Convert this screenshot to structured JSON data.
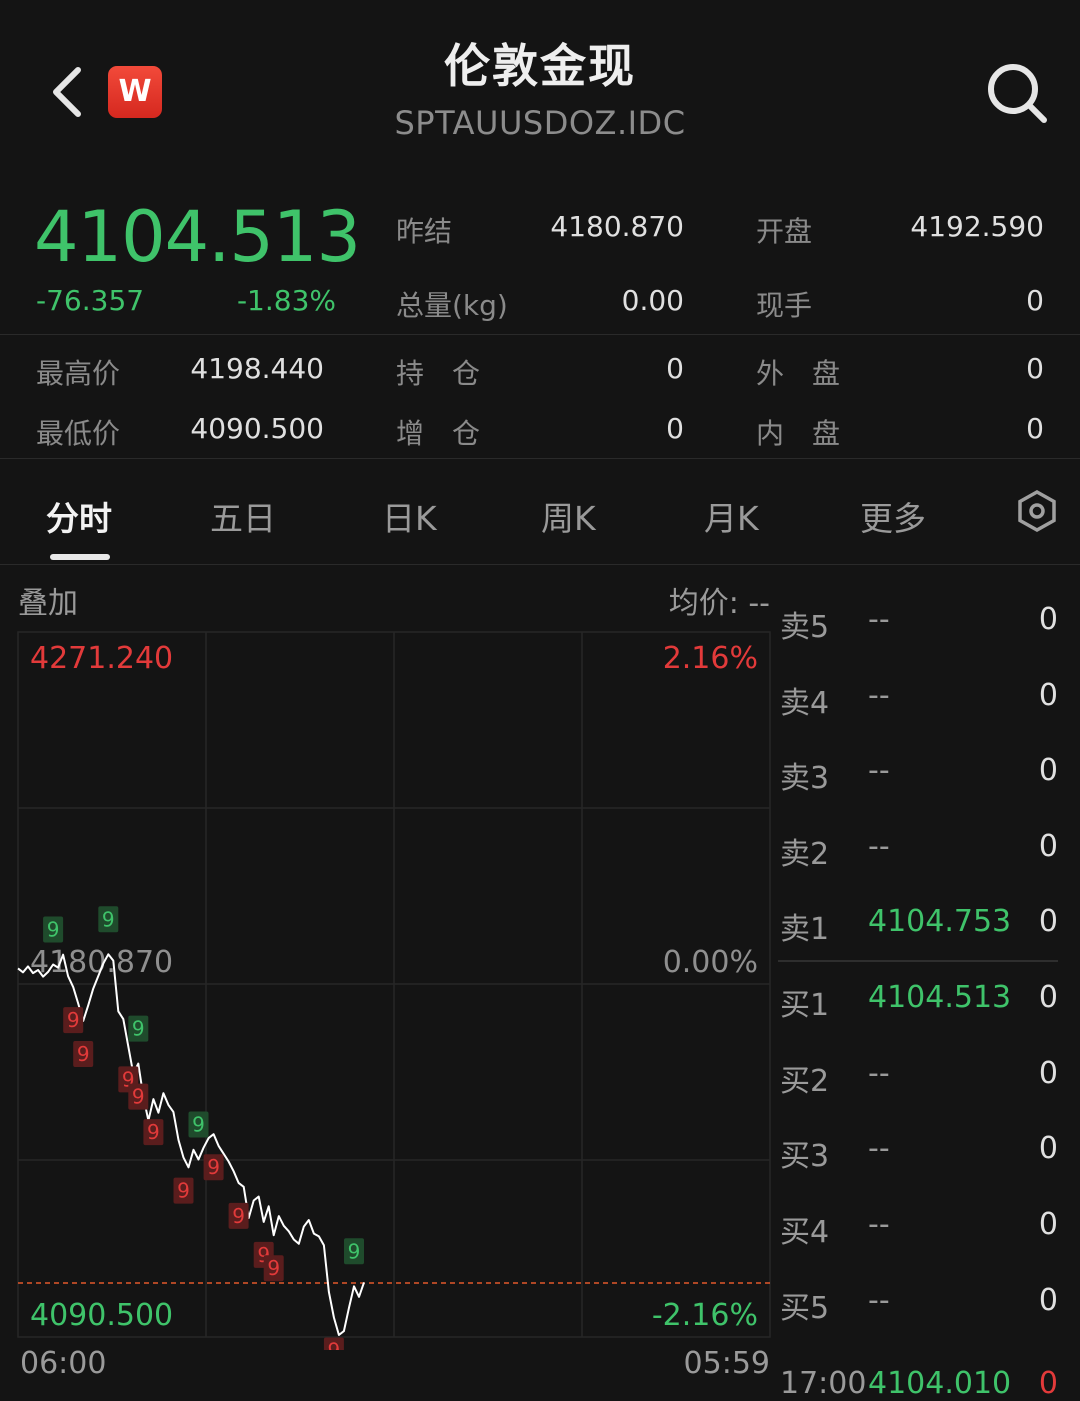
{
  "header": {
    "title": "伦敦金现",
    "subtitle": "SPTAUUSDOZ.IDC",
    "logo_letter": "W"
  },
  "quote": {
    "price": "4104.513",
    "change": "-76.357",
    "change_pct": "-1.83%",
    "stats": {
      "prev_settle_label": "昨结",
      "prev_settle": "4180.870",
      "open_label": "开盘",
      "open": "4192.590",
      "volume_label": "总量(kg)",
      "volume": "0.00",
      "current_hand_label": "现手",
      "current_hand": "0",
      "high_label": "最高价",
      "high": "4198.440",
      "position_label": "持　仓",
      "position": "0",
      "outer_label": "外　盘",
      "outer": "0",
      "low_label": "最低价",
      "low": "4090.500",
      "increase_label": "增　仓",
      "increase": "0",
      "inner_label": "内　盘",
      "inner": "0"
    }
  },
  "tabs": [
    "分时",
    "五日",
    "日K",
    "周K",
    "月K",
    "更多"
  ],
  "chart": {
    "overlay_label": "叠加",
    "avg_label": "均价: --",
    "top_value": "4271.240",
    "top_pct": "2.16%",
    "mid_value": "4180.870",
    "mid_pct": "0.00%",
    "bottom_value": "4090.500",
    "bottom_pct": "-2.16%",
    "time_start": "06:00",
    "time_end": "05:59"
  },
  "chart_data": {
    "type": "line",
    "title": "",
    "ylim": [
      4090.5,
      4271.24
    ],
    "reference_price": 4180.87,
    "x": [
      "06:00",
      "",
      "",
      "",
      "",
      "",
      "",
      "",
      "",
      "",
      "",
      "",
      "",
      "",
      "",
      "",
      "",
      "",
      "",
      "",
      "",
      "",
      "",
      "",
      "",
      "",
      "",
      "",
      "",
      "",
      "",
      "",
      "",
      "",
      "",
      "",
      "",
      "",
      "",
      "",
      "",
      "",
      "",
      "",
      "",
      "",
      "",
      "",
      "",
      "",
      "",
      "",
      "",
      "",
      "",
      "",
      "",
      "",
      "",
      "",
      "",
      "",
      "",
      "",
      "",
      "",
      "",
      "",
      "",
      ""
    ],
    "series": [
      {
        "values": [
          4185.0,
          4184.0,
          4185.5,
          4183.8,
          4184.6,
          4182.9,
          4184.1,
          4186.0,
          4185.2,
          4188.5,
          4183.0,
          4180.2,
          4176.0,
          4171.5,
          4175.5,
          4179.8,
          4183.0,
          4186.2,
          4188.6,
          4187.0,
          4174.0,
          4172.0,
          4165.0,
          4158.0,
          4160.6,
          4152.0,
          4146.0,
          4151.5,
          4148.0,
          4153.0,
          4150.0,
          4148.2,
          4141.0,
          4136.5,
          4134.0,
          4138.5,
          4136.0,
          4139.0,
          4141.5,
          4142.5,
          4139.5,
          4137.5,
          4135.5,
          4133.0,
          4130.0,
          4129.0,
          4121.0,
          4125.5,
          4126.5,
          4120.0,
          4124.0,
          4116.6,
          4121.5,
          4119.0,
          4117.6,
          4115.5,
          4114.4,
          4118.8,
          4120.5,
          4117.0,
          4116.3,
          4114.0,
          4102.0,
          4095.5,
          4091.0,
          4092.0,
          4098.0,
          4103.5,
          4100.8,
          4104.5
        ]
      }
    ],
    "markers": [
      {
        "label": "9",
        "color": "#3fc36a",
        "x_index": 7
      },
      {
        "label": "9",
        "color": "#3fc36a",
        "x_index": 18
      },
      {
        "label": "9",
        "color": "#e23a3a",
        "x_index": 11
      },
      {
        "label": "9",
        "color": "#e23a3a",
        "x_index": 13
      },
      {
        "label": "9",
        "color": "#e23a3a",
        "x_index": 22
      },
      {
        "label": "9",
        "color": "#3fc36a",
        "x_index": 24
      },
      {
        "label": "9",
        "color": "#e23a3a",
        "x_index": 24
      },
      {
        "label": "9",
        "color": "#e23a3a",
        "x_index": 27
      },
      {
        "label": "9",
        "color": "#3fc36a",
        "x_index": 36
      },
      {
        "label": "9",
        "color": "#e23a3a",
        "x_index": 33
      },
      {
        "label": "9",
        "color": "#e23a3a",
        "x_index": 39
      },
      {
        "label": "9",
        "color": "#e23a3a",
        "x_index": 44
      },
      {
        "label": "9",
        "color": "#e23a3a",
        "x_index": 49
      },
      {
        "label": "9",
        "color": "#e23a3a",
        "x_index": 51
      },
      {
        "label": "9",
        "color": "#e23a3a",
        "x_index": 63
      },
      {
        "label": "9",
        "color": "#3fc36a",
        "x_index": 67
      }
    ]
  },
  "order_book": {
    "rows": [
      {
        "label": "卖5",
        "price": "--",
        "vol": "0",
        "green": false
      },
      {
        "label": "卖4",
        "price": "--",
        "vol": "0",
        "green": false
      },
      {
        "label": "卖3",
        "price": "--",
        "vol": "0",
        "green": false
      },
      {
        "label": "卖2",
        "price": "--",
        "vol": "0",
        "green": false
      },
      {
        "label": "卖1",
        "price": "4104.753",
        "vol": "0",
        "green": true
      },
      {
        "label": "买1",
        "price": "4104.513",
        "vol": "0",
        "green": true
      },
      {
        "label": "买2",
        "price": "--",
        "vol": "0",
        "green": false
      },
      {
        "label": "买3",
        "price": "--",
        "vol": "0",
        "green": false
      },
      {
        "label": "买4",
        "price": "--",
        "vol": "0",
        "green": false
      },
      {
        "label": "买5",
        "price": "--",
        "vol": "0",
        "green": false
      }
    ],
    "tick": {
      "time": "17:00",
      "price": "4104.010",
      "vol": "0"
    }
  },
  "colors": {
    "up": "#e23a3a",
    "down": "#3fc36a",
    "line": "#ffffff",
    "background": "#141414"
  }
}
